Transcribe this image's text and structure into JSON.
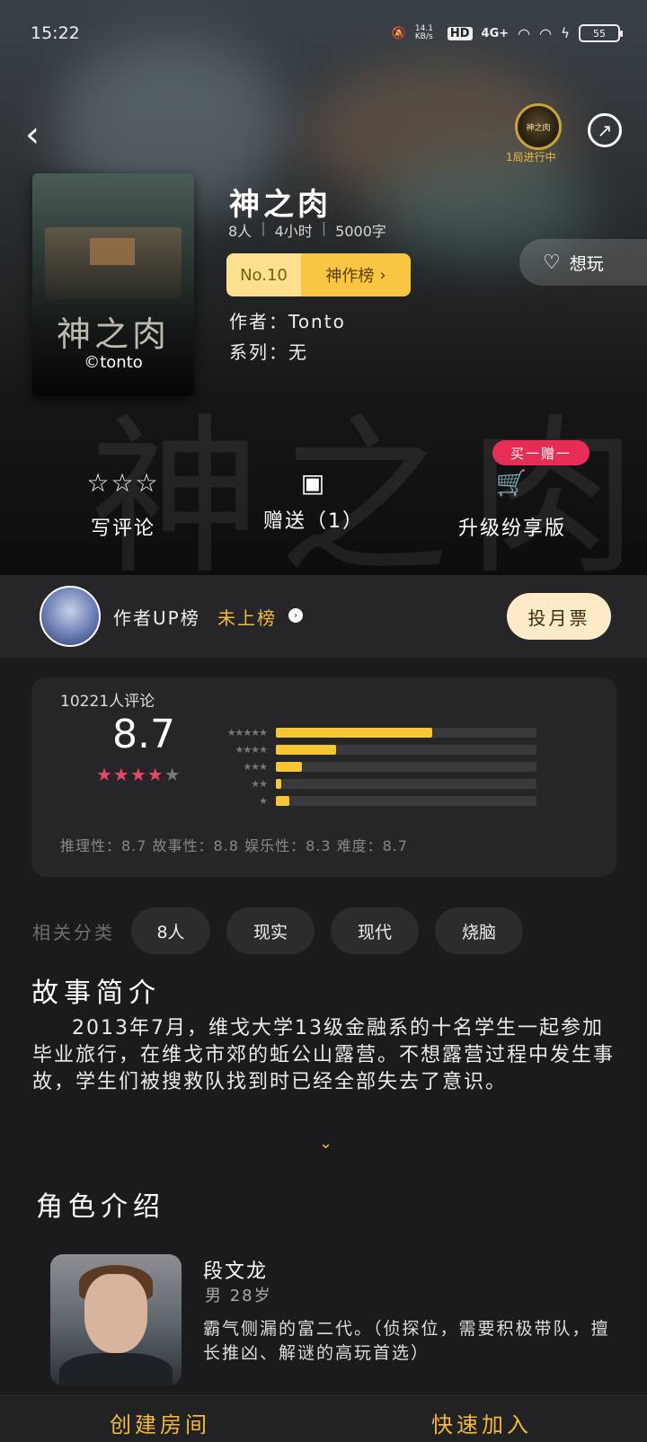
{
  "status": {
    "time": "15:22",
    "speed": "14.1 KB/s",
    "hd": "HD",
    "network": "4G+",
    "battery": "55"
  },
  "header": {
    "token_label": "1局进行中",
    "token_text": "神之肉"
  },
  "game": {
    "cover_title": "神之肉",
    "cover_author": "©tonto",
    "title": "神之肉",
    "players": "8人",
    "duration": "4小时",
    "words": "5000字",
    "rank_no": "No.10",
    "rank_board": "神作榜",
    "author_line": "作者：Tonto",
    "series_line": "系列：无",
    "want_label": "想玩"
  },
  "actions": {
    "review_label": "写评论",
    "gift_label": "赠送（1）",
    "upgrade_label": "升级纷享版",
    "promo": "买一赠一"
  },
  "author_rank": {
    "label": "作者UP榜",
    "status": "未上榜",
    "vote_button": "投月票"
  },
  "rating": {
    "count": "10221人评论",
    "score": "8.7",
    "stars_full": "★★★★",
    "stars_half": "★",
    "levels": [
      {
        "stars": "★★★★★",
        "fraction": 0.6
      },
      {
        "stars": "★★★★",
        "fraction": 0.23
      },
      {
        "stars": "★★★",
        "fraction": 0.1
      },
      {
        "stars": "★★",
        "fraction": 0.02
      },
      {
        "stars": "★",
        "fraction": 0.05
      }
    ],
    "dims": "推理性：8.7  故事性：8.8  娱乐性：8.3  难度：8.7"
  },
  "tags": {
    "label": "相关分类",
    "items": [
      "8人",
      "现实",
      "现代",
      "烧脑"
    ]
  },
  "story": {
    "title": "故事简介",
    "text": "2013年7月，维戈大学13级金融系的十名学生一起参加毕业旅行，在维戈市郊的蚯公山露营。不想露营过程中发生事故，学生们被搜救队找到时已经全部失去了意识。"
  },
  "characters": {
    "title": "角色介绍",
    "list": [
      {
        "name": "段文龙",
        "sub": "男  28岁",
        "desc": "霸气侧漏的富二代。（侦探位，需要积极带队，擅长推凶、解谜的高玩首选）"
      }
    ]
  },
  "bottom": {
    "create_room": "创建房间",
    "quick_join": "快速加入"
  },
  "colors": {
    "accent": "#f3b93a",
    "pink": "#e72d56",
    "star": "#e84668",
    "bar": "#f7c634"
  }
}
